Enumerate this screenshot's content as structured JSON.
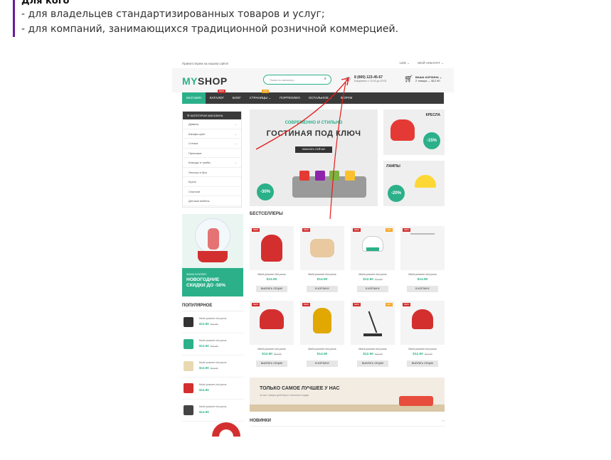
{
  "intro": {
    "title": "Для кого",
    "lines": [
      "- для владельцев стандартизированных товаров и услуг;",
      "- для компаний, занимающихся традиционной розничной коммерцией."
    ]
  },
  "shop": {
    "topbar": {
      "welcome": "Приветствуем на нашем сайте!",
      "currency": "USD ⌄",
      "account": "МОЙ АККАУНТ ⌄"
    },
    "logo": {
      "part1": "MY",
      "part2": "SHOP"
    },
    "search_placeholder": "Поиск по каталогу...",
    "phone": {
      "number": "8 (800) 123-45-67",
      "hours": "Ежедневно с 10:00 до 20:00"
    },
    "cart": {
      "title": "ВАША КОРЗИНА ⌄",
      "summary": "2 товара — $12.90"
    },
    "nav": [
      "МАГАЗИН",
      "КАТАЛОГ",
      "БЛОГ",
      "СТРАНИЦЫ ⌄",
      "ПОРТФОЛИО",
      "ОСТАЛЬНОЕ ⌄",
      "ФОРУМ"
    ],
    "nav_badges": {
      "new": "NEW",
      "hot": "HOT"
    },
    "categories": {
      "title": "☰ КАТЕГОРИИ МАГАЗИНА",
      "items": [
        "Диваны",
        "Шкафы-купе",
        "Стенки",
        "Прихожие",
        "Комоды и тумбы",
        "Люстры и бра",
        "Кухни",
        "Спальни",
        "Детская мебель"
      ]
    },
    "promo": {
      "small": "ЗИМА БЛИЗКО",
      "big": "НОВОГОДНИЕ СКИДКИ ДО -50%"
    },
    "popular": {
      "title": "ПОПУЛЯРНОЕ",
      "items": [
        {
          "name": "Morbi posuere nisi purus",
          "price": "$12.90",
          "old": "$17.00",
          "color": "#333333"
        },
        {
          "name": "Morbi posuere nisi purus",
          "price": "$12.90",
          "old": "$17.00",
          "color": "#2bb08a"
        },
        {
          "name": "Morbi posuere nisi purus",
          "price": "$12.90",
          "old": "$17.00",
          "color": "#e8d9b0"
        },
        {
          "name": "Morbi posuere nisi purus",
          "price": "$14.90",
          "old": "",
          "color": "#d32f2f"
        },
        {
          "name": "Morbi posuere nisi purus",
          "price": "$14.90",
          "old": "",
          "color": "#444444"
        }
      ]
    },
    "hero": {
      "line1": "СОВРЕМЕННО И СТИЛЬНО",
      "line2": "ГОСТИНАЯ ПОД КЛЮЧ",
      "button": "ЗАКАЗАТЬ СЕЙЧАС",
      "discount": "-30%"
    },
    "tiles": [
      {
        "label": "КРЕСЛА",
        "discount": "-15%"
      },
      {
        "label": "ЛАМПЫ",
        "discount": "-20%"
      }
    ],
    "bestsellers": {
      "title": "БЕСТСЕЛЛЕРЫ",
      "products": [
        {
          "tag": "NEW",
          "hot": "",
          "name": "Morbi posuere nisi purus",
          "price": "$14.90",
          "old": "",
          "button": "ВЫБРАТЬ ОПЦИИ",
          "color": "#d32f2f"
        },
        {
          "tag": "NEW",
          "hot": "",
          "name": "Morbi posuere nisi purus",
          "price": "$14.90",
          "old": "",
          "button": "В КОРЗИНУ",
          "color": "#e8c9a0"
        },
        {
          "tag": "NEW",
          "hot": "HOT",
          "name": "Morbi posuere nisi purus",
          "price": "$12.90",
          "old": "$17.00",
          "button": "В КОРЗИНУ",
          "color": "#2bb08a"
        },
        {
          "tag": "NEW",
          "hot": "",
          "name": "Morbi posuere nisi purus",
          "price": "$14.90",
          "old": "",
          "button": "В КОРЗИНУ",
          "color": "#bbbbbb"
        },
        {
          "tag": "NEW",
          "hot": "",
          "name": "Morbi posuere nisi purus",
          "price": "$12.90",
          "old": "$17.00",
          "button": "ВЫБРАТЬ ОПЦИИ",
          "color": "#d32f2f"
        },
        {
          "tag": "NEW",
          "hot": "",
          "name": "Morbi posuere nisi purus",
          "price": "$14.90",
          "old": "",
          "button": "В КОРЗИНУ",
          "color": "#e0a800"
        },
        {
          "tag": "NEW",
          "hot": "HOT",
          "name": "Morbi posuere nisi purus",
          "price": "$12.90",
          "old": "$17.00",
          "button": "ВЫБРАТЬ ОПЦИИ",
          "color": "#333333"
        },
        {
          "tag": "NEW",
          "hot": "",
          "name": "Morbi posuere nisi purus",
          "price": "$12.90",
          "old": "$17.00",
          "button": "ВЫБРАТЬ ОПЦИИ",
          "color": "#d32f2f"
        }
      ]
    },
    "banner": {
      "title": "ТОЛЬКО САМОЕ ЛУЧШЕЕ У НАС",
      "sub": "на все товары действуют сезонные скидки"
    },
    "new_title": "НОВИНКИ",
    "arrows": "‹ ›"
  },
  "colors": {
    "accent": "#2bb08a",
    "dark": "#3a3a3a",
    "red": "#d32f2f",
    "intro_bar": "#6a1b9a"
  }
}
